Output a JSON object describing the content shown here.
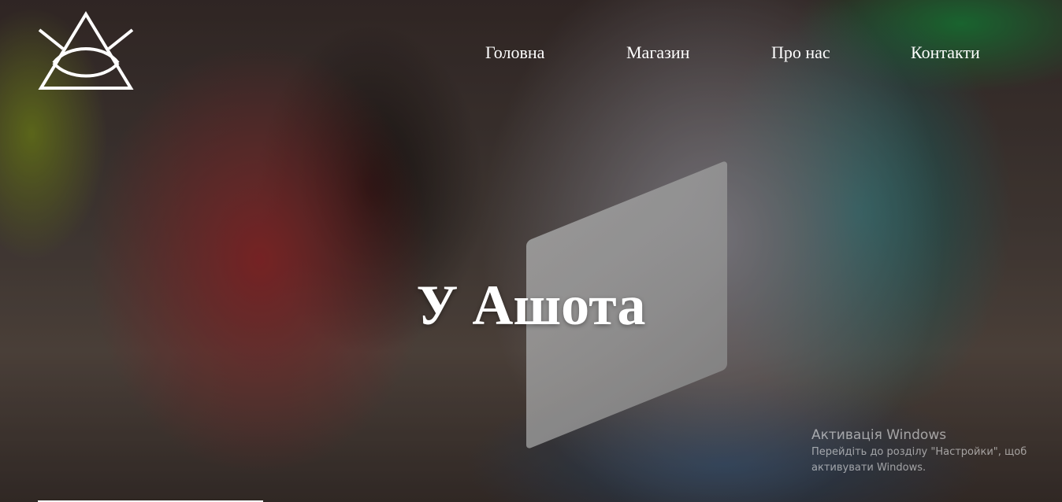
{
  "site": {
    "logo_icon": "triangle-eye-logo-icon"
  },
  "nav": {
    "items": [
      {
        "label": "Головна"
      },
      {
        "label": "Магазин"
      },
      {
        "label": "Про нас"
      },
      {
        "label": "Контакти"
      }
    ]
  },
  "hero": {
    "title": "У Ашота",
    "background_image": "two-people-smiling-looking-at-tablet-photo"
  },
  "windows_watermark": {
    "title": "Активація Windows",
    "line1": "Перейдіть до розділу \"Настройки\", щоб",
    "line2": "активувати Windows."
  },
  "colors": {
    "text": "#ffffff",
    "accent_teal": "#1f6b6a",
    "cardigan_red": "#8f2a2c"
  }
}
